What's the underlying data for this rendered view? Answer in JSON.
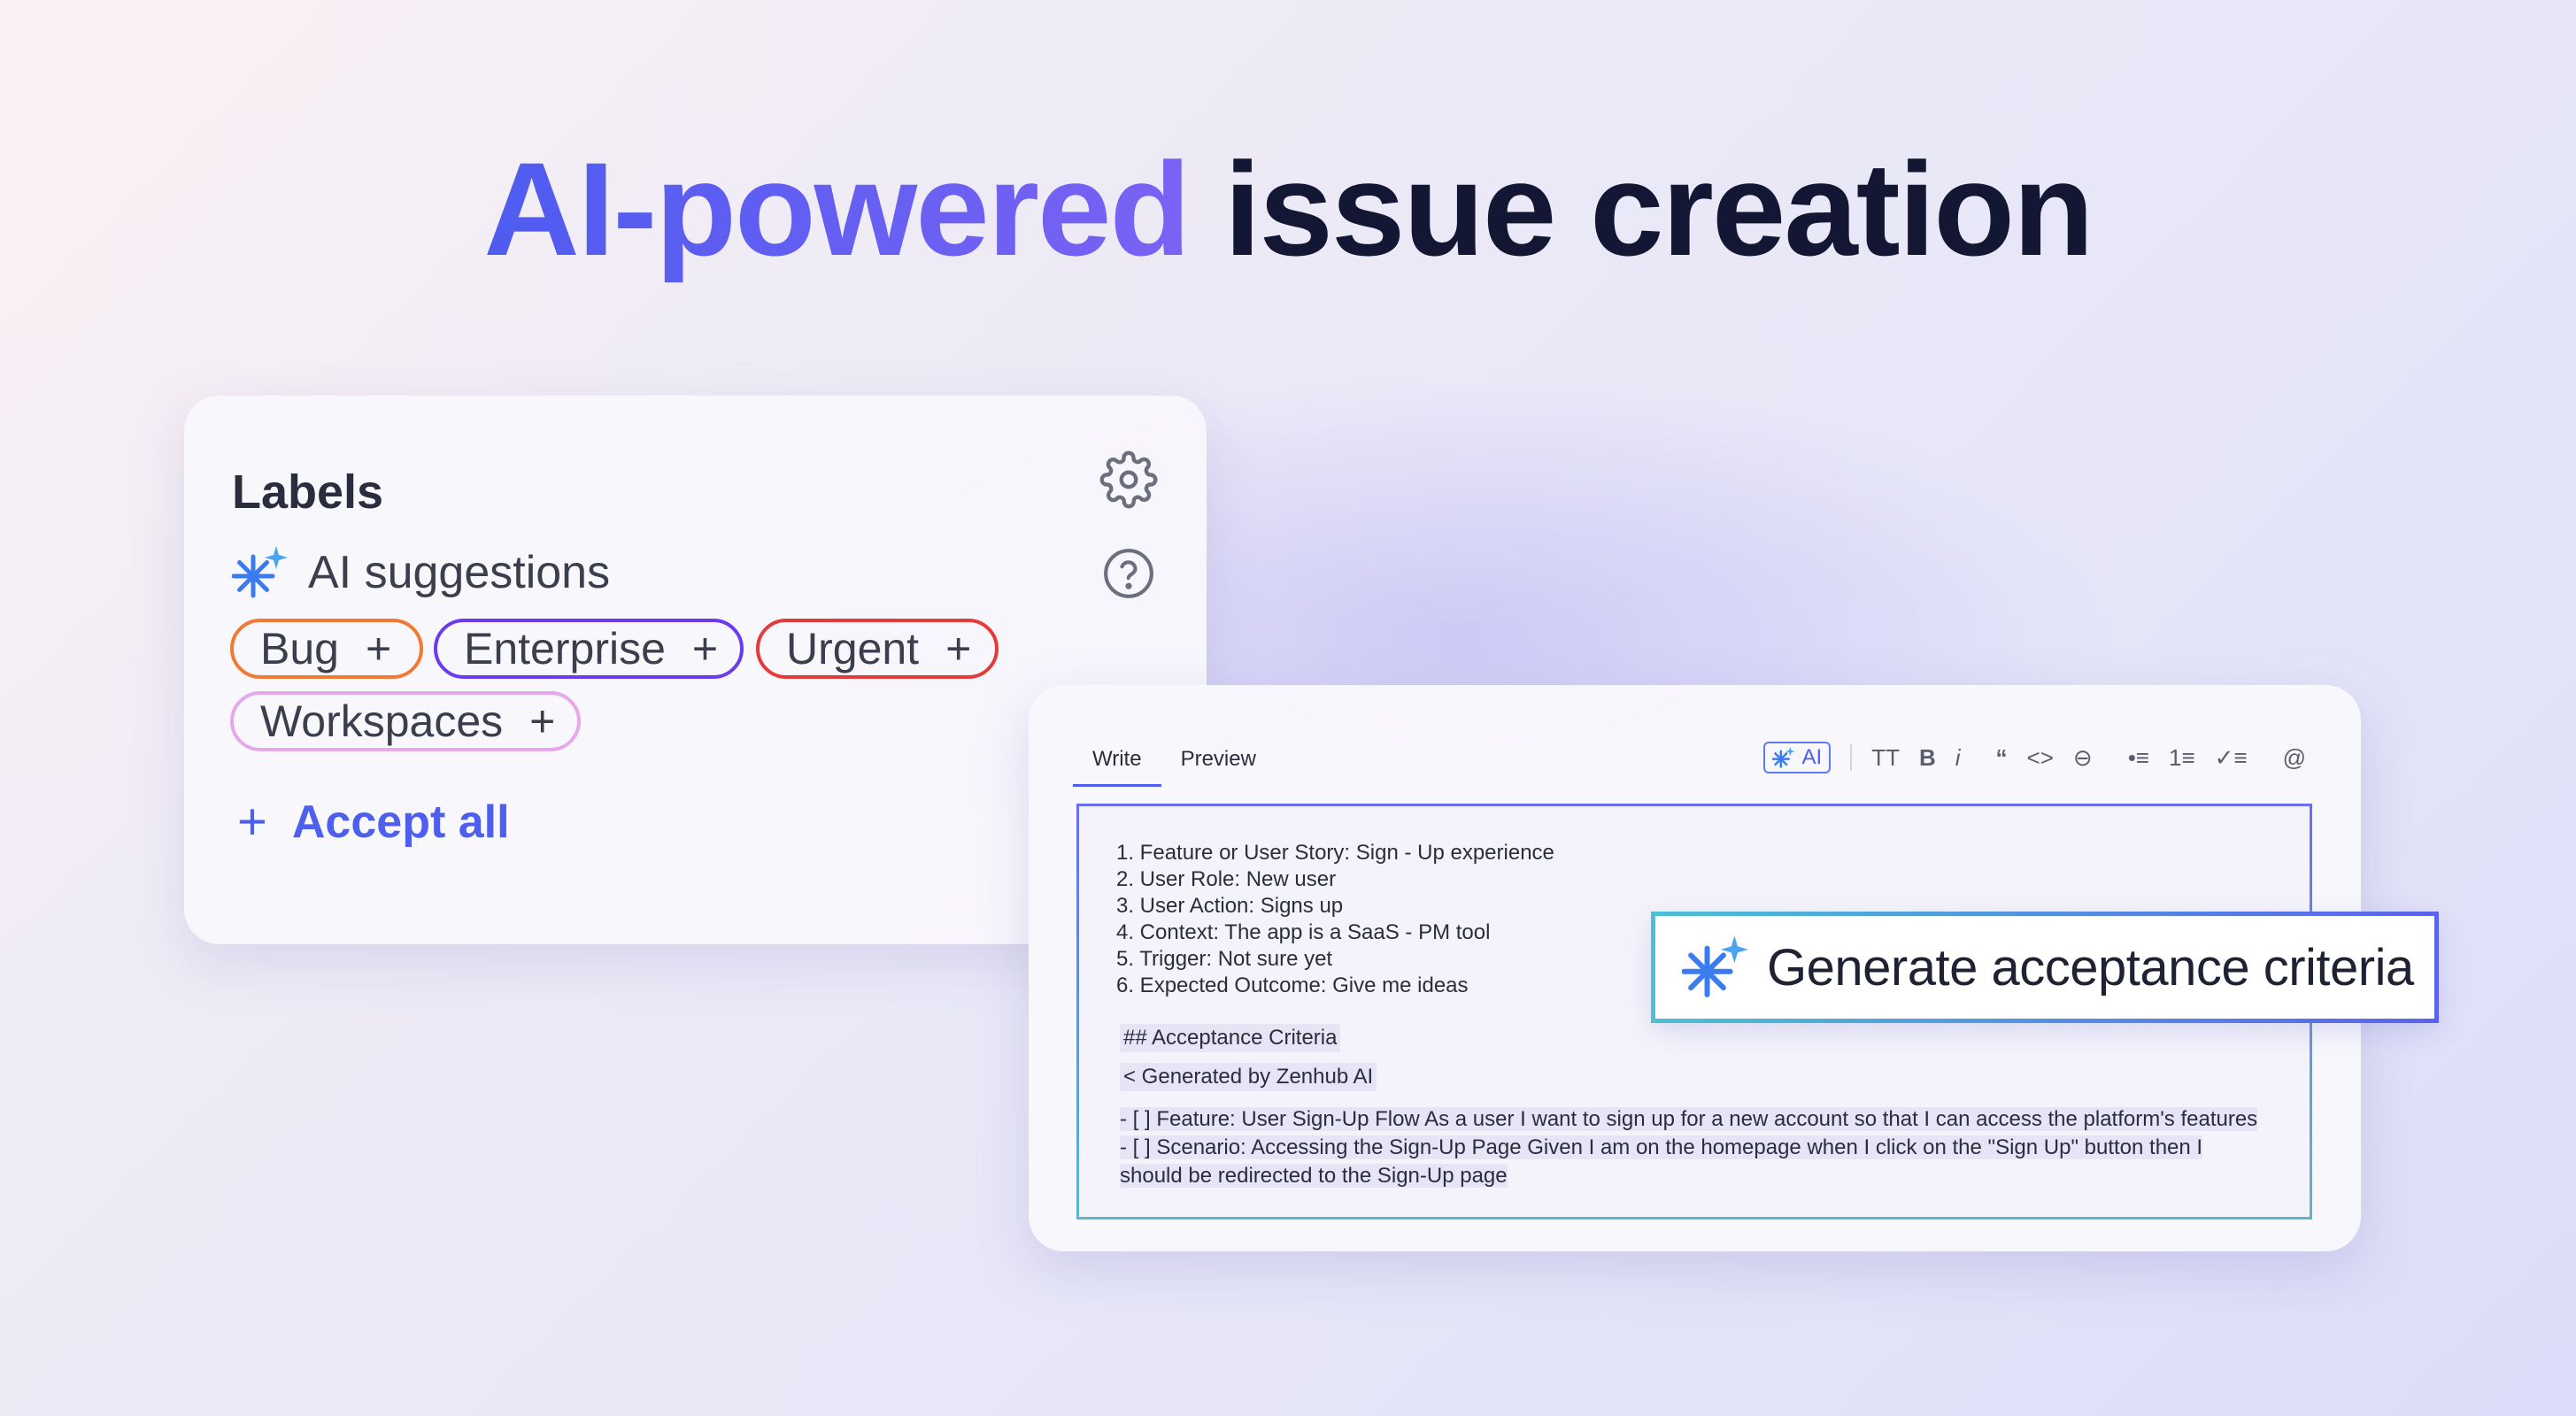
{
  "headline": {
    "accent": "AI-powered",
    "rest": "issue creation"
  },
  "labels_card": {
    "title": "Labels",
    "ai_suggestions": "AI suggestions",
    "chips": [
      {
        "label": "Bug",
        "color": "#f07a34"
      },
      {
        "label": "Enterprise",
        "color": "#6b3bf0"
      },
      {
        "label": "Urgent",
        "color": "#e53a3a"
      },
      {
        "label": "Workspaces",
        "color": "#e5a8ea"
      }
    ],
    "chip_plus": "+",
    "accept_all": "Accept all",
    "accept_plus": "+",
    "icons": [
      "gear-icon",
      "help-icon",
      "sparkle-icon"
    ]
  },
  "editor": {
    "tabs": [
      "Write",
      "Preview"
    ],
    "toolbar": {
      "ai": "AI",
      "text_size": "TT",
      "bold": "B",
      "italic": "i",
      "quote": "“",
      "code": "<>",
      "link": "⊖",
      "bullet_list": "•≡",
      "numbered_list": "1≡",
      "task_list": "✓≡",
      "mention": "@"
    },
    "lines": [
      "1. Feature or User Story: Sign - Up experience",
      "2. User Role: New user",
      "3. User Action: Signs up",
      "4. Context: The app is a SaaS - PM tool",
      "5. Trigger: Not sure yet",
      "6. Expected Outcome: Give me ideas"
    ],
    "heading": "## Acceptance Criteria",
    "generated_by": "< Generated by Zenhub AI",
    "criteria_1": "- [ ] Feature: User Sign-Up Flow As a user I want to sign up for a new account so that I can access the platform's features",
    "criteria_2": "- [ ] Scenario: Accessing the Sign-Up Page Given I am on the homepage when I click on the \"Sign Up\" button then I",
    "criteria_3": "should be redirected to the Sign-Up page"
  },
  "generate_button": {
    "label": "Generate acceptance criteria"
  },
  "colors": {
    "accent": "#4d5fec",
    "text": "#141733"
  }
}
